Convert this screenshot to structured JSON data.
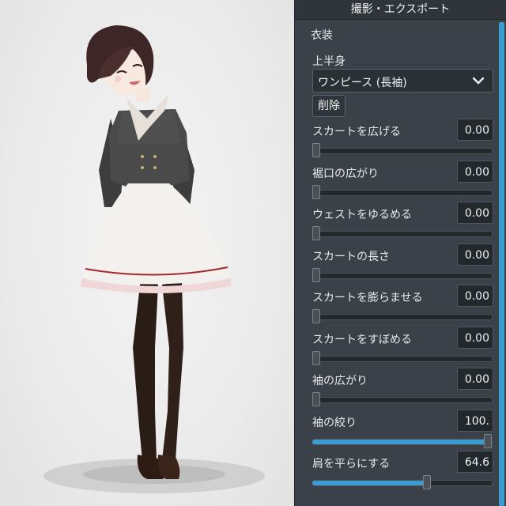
{
  "panel": {
    "title": "撮影・エクスポート",
    "section": "衣装",
    "upper_body_label": "上半身",
    "dropdown_value": "ワンピース (長袖)",
    "delete_label": "削除"
  },
  "sliders": [
    {
      "label": "スカートを広げる",
      "value_text": "0.00",
      "fraction": 0.0
    },
    {
      "label": "裾口の広がり",
      "value_text": "0.00",
      "fraction": 0.0
    },
    {
      "label": "ウェストをゆるめる",
      "value_text": "0.00",
      "fraction": 0.0
    },
    {
      "label": "スカートの長さ",
      "value_text": "0.00",
      "fraction": 0.0
    },
    {
      "label": "スカートを膨らませる",
      "value_text": "0.00",
      "fraction": 0.0
    },
    {
      "label": "スカートをすぼめる",
      "value_text": "0.00",
      "fraction": 0.0
    },
    {
      "label": "袖の広がり",
      "value_text": "0.00",
      "fraction": 0.0
    },
    {
      "label": "袖の絞り",
      "value_text": "100.",
      "fraction": 1.0
    },
    {
      "label": "肩を平らにする",
      "value_text": "64.6",
      "fraction": 0.646
    }
  ],
  "colors": {
    "accent": "#3c9bd0",
    "panel_bg": "#3b4148"
  }
}
